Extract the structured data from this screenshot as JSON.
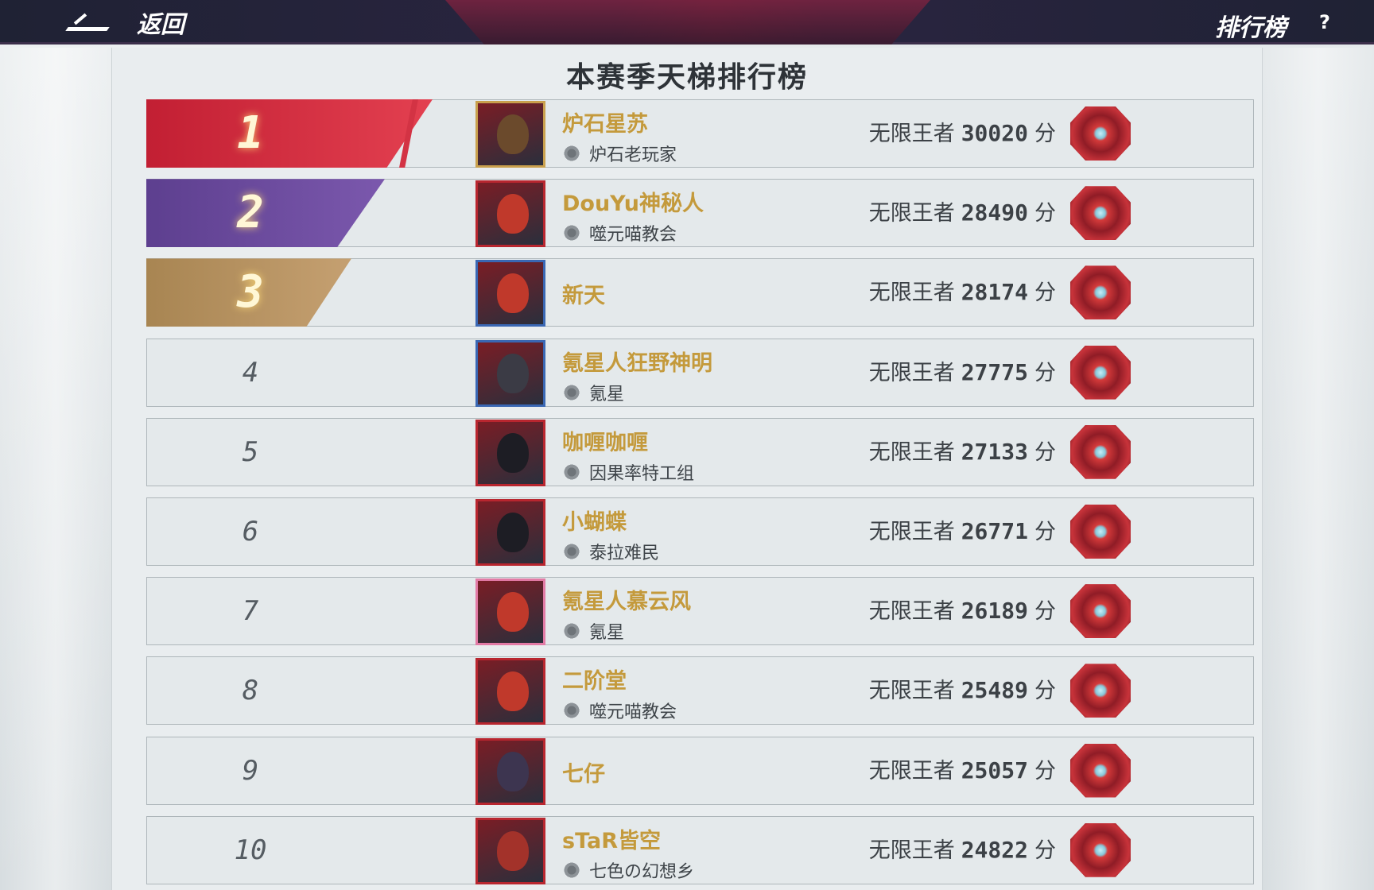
{
  "topbar": {
    "back_label": "返回",
    "title": "排行榜",
    "help": "?"
  },
  "board": {
    "title": "本赛季天梯排行榜",
    "tier_label": "无限王者",
    "unit": "分",
    "rows": [
      {
        "rank": "1",
        "name": "炉石星苏",
        "guild": "炉石老玩家",
        "score": "30020"
      },
      {
        "rank": "2",
        "name": "DouYu神秘人",
        "guild": "噬元喵教会",
        "score": "28490"
      },
      {
        "rank": "3",
        "name": "新天",
        "guild": "",
        "score": "28174"
      },
      {
        "rank": "4",
        "name": "氪星人狂野神明",
        "guild": "氪星",
        "score": "27775"
      },
      {
        "rank": "5",
        "name": "咖喱咖喱",
        "guild": "因果率特工组",
        "score": "27133"
      },
      {
        "rank": "6",
        "name": "小蝴蝶",
        "guild": "泰拉难民",
        "score": "26771"
      },
      {
        "rank": "7",
        "name": "氪星人慕云风",
        "guild": "氪星",
        "score": "26189"
      },
      {
        "rank": "8",
        "name": "二阶堂",
        "guild": "噬元喵教会",
        "score": "25489"
      },
      {
        "rank": "9",
        "name": "七仔",
        "guild": "",
        "score": "25057"
      },
      {
        "rank": "10",
        "name": "sTaR皆空",
        "guild": "七色の幻想乡",
        "score": "24822"
      }
    ]
  },
  "colors": {
    "rank1": "#c21f33",
    "rank2": "#5d3f8f",
    "rank3": "#a88552",
    "name": "#c49a3c"
  }
}
